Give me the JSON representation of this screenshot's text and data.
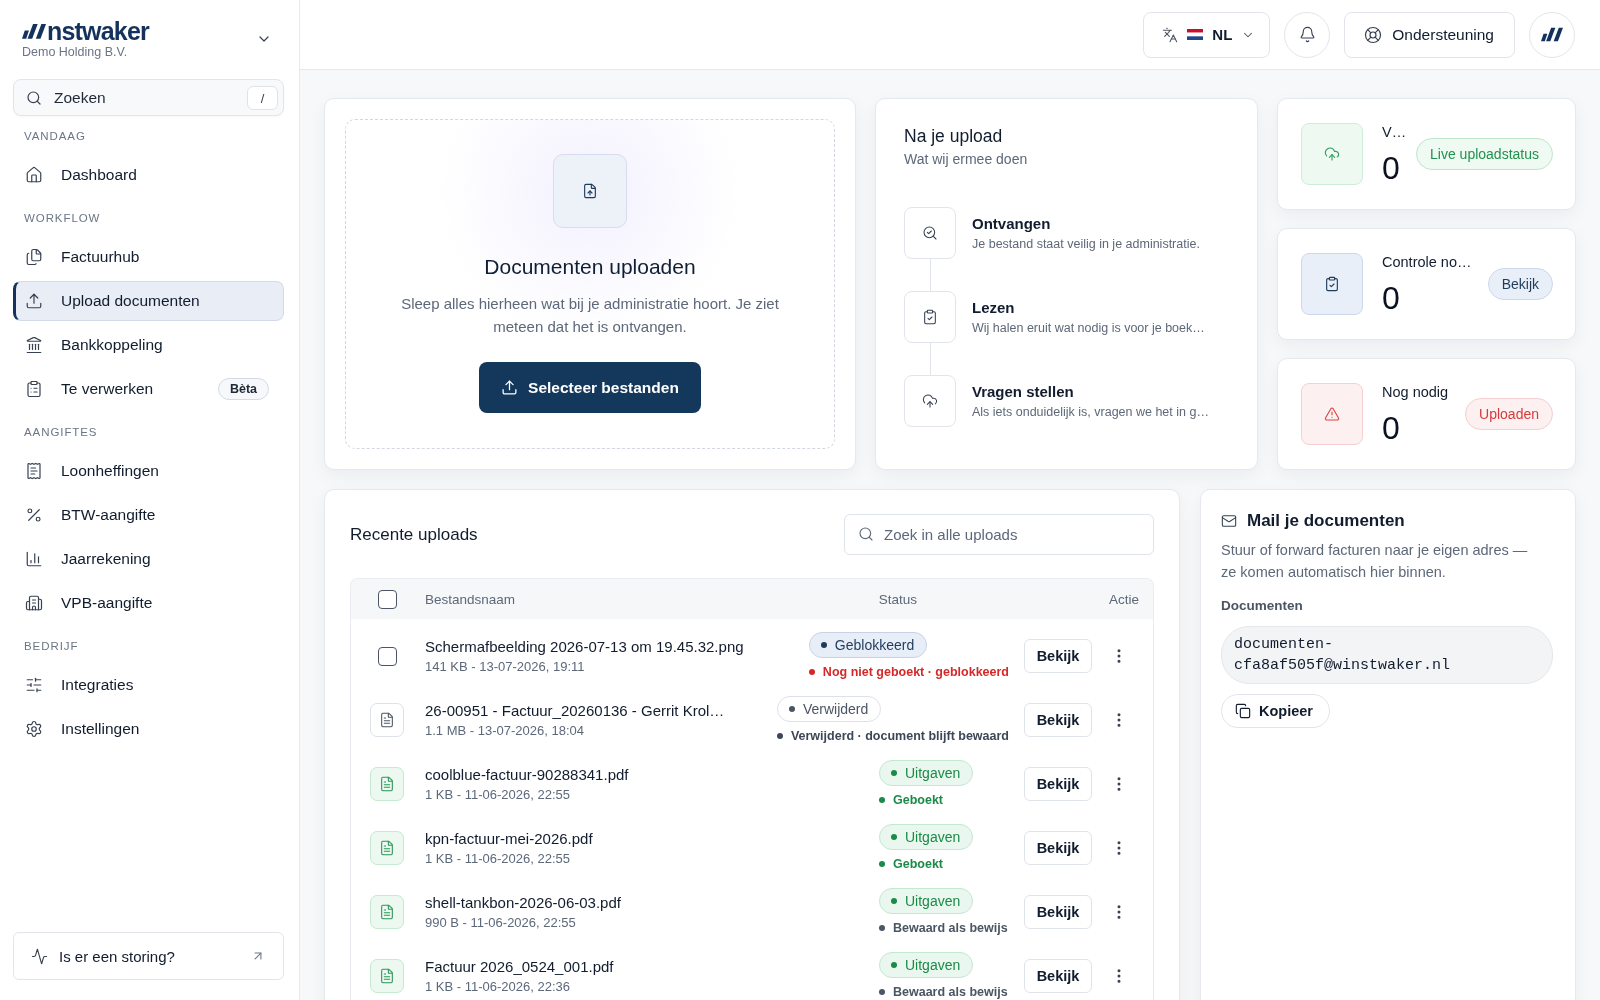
{
  "sidebar": {
    "brand": {
      "name": "nstwaker",
      "company": "Demo Holding B.V."
    },
    "search": {
      "placeholder": "Zoeken",
      "shortcut": "/"
    },
    "sections": [
      {
        "label": "VANDAAG",
        "items": [
          {
            "label": "Dashboard",
            "selected": false
          }
        ]
      },
      {
        "label": "WORKFLOW",
        "items": [
          {
            "label": "Factuurhub",
            "selected": false
          },
          {
            "label": "Upload documenten",
            "selected": true
          },
          {
            "label": "Bankkoppeling",
            "selected": false
          },
          {
            "label": "Te verwerken",
            "selected": false,
            "badge": "Bèta"
          }
        ]
      },
      {
        "label": "AANGIFTES",
        "items": [
          {
            "label": "Loonheffingen",
            "selected": false
          },
          {
            "label": "BTW-aangifte",
            "selected": false
          },
          {
            "label": "Jaarrekening",
            "selected": false
          },
          {
            "label": "VPB-aangifte",
            "selected": false
          }
        ]
      },
      {
        "label": "BEDRIJF",
        "items": [
          {
            "label": "Integraties",
            "selected": false
          },
          {
            "label": "Instellingen",
            "selected": false
          }
        ]
      }
    ],
    "status_link": {
      "label": "Is er een storing?"
    }
  },
  "topbar": {
    "language": {
      "code": "NL"
    },
    "support": {
      "label": "Ondersteuning"
    }
  },
  "upload": {
    "title": "Documenten uploaden",
    "description": "Sleep alles hierheen wat bij je administratie hoort. Je ziet meteen dat het is ontvangen.",
    "button": "Selecteer bestanden"
  },
  "after_upload": {
    "title": "Na je upload",
    "subtitle": "Wat wij ermee doen",
    "steps": [
      {
        "title": "Ontvangen",
        "description": "Je bestand staat veilig in je administratie."
      },
      {
        "title": "Lezen",
        "description": "Wij halen eruit wat nodig is voor je boek…"
      },
      {
        "title": "Vragen stellen",
        "description": "Als iets onduidelijk is, vragen we het in g…"
      }
    ]
  },
  "stats": [
    {
      "label": "V…",
      "value": "0",
      "kind": "upload",
      "action": "Live uploadstatus"
    },
    {
      "label": "Controle no…",
      "value": "0",
      "kind": "review",
      "action": "Bekijk"
    },
    {
      "label": "Nog nodig",
      "value": "0",
      "kind": "missing",
      "action": "Uploaden"
    }
  ],
  "recent_uploads": {
    "title": "Recente uploads",
    "search": {
      "placeholder": "Zoek in alle uploads"
    },
    "table": {
      "columns": [
        "Bestandsnaam",
        "Status",
        "Actie"
      ],
      "select_all": {
        "checked": false
      },
      "rows": [
        {
          "lead": {
            "kind": "checkbox",
            "checked": false
          },
          "name": "Schermafbeelding 2026-07-13 om 19.45.32.png",
          "meta": "141 KB - 13-07-2026, 19:11",
          "status": {
            "label": "Geblokkeerd",
            "kind": "blocked"
          },
          "note": {
            "label": "Nog niet geboekt · geblokkeerd",
            "kind": "error"
          },
          "action": "Bekijk"
        },
        {
          "lead": {
            "kind": "file"
          },
          "name": "26-00951 - Factuur_20260136 - Gerrit Krol…",
          "meta": "1.1 MB - 13-07-2026, 18:04",
          "status": {
            "label": "Verwijderd",
            "kind": "deleted"
          },
          "note": {
            "label": "Verwijderd · document blijft bewaard",
            "kind": "deleted"
          },
          "action": "Bekijk"
        },
        {
          "lead": {
            "kind": "expense"
          },
          "name": "coolblue-factuur-90288341.pdf",
          "meta": "1 KB - 11-06-2026, 22:55",
          "status": {
            "label": "Uitgaven",
            "kind": "expense"
          },
          "note": {
            "label": "Geboekt",
            "kind": "booked"
          },
          "action": "Bekijk"
        },
        {
          "lead": {
            "kind": "expense"
          },
          "name": "kpn-factuur-mei-2026.pdf",
          "meta": "1 KB - 11-06-2026, 22:55",
          "status": {
            "label": "Uitgaven",
            "kind": "expense"
          },
          "note": {
            "label": "Geboekt",
            "kind": "booked"
          },
          "action": "Bekijk"
        },
        {
          "lead": {
            "kind": "expense"
          },
          "name": "shell-tankbon-2026-06-03.pdf",
          "meta": "990 B - 11-06-2026, 22:55",
          "status": {
            "label": "Uitgaven",
            "kind": "expense"
          },
          "note": {
            "label": "Bewaard als bewijs",
            "kind": "archived"
          },
          "action": "Bekijk"
        },
        {
          "lead": {
            "kind": "expense"
          },
          "name": "Factuur 2026_0524_001.pdf",
          "meta": "1 KB - 11-06-2026, 22:36",
          "status": {
            "label": "Uitgaven",
            "kind": "expense"
          },
          "note": {
            "label": "Bewaard als bewijs",
            "kind": "archived"
          },
          "action": "Bekijk"
        }
      ]
    }
  },
  "mail": {
    "title": "Mail je documenten",
    "description": "Stuur of forward facturen naar je eigen adres — ze komen automatisch hier binnen.",
    "address_label": "Documenten",
    "address": "documenten-cfa8af505f@winstwaker.nl",
    "copy_button": "Kopieer"
  }
}
